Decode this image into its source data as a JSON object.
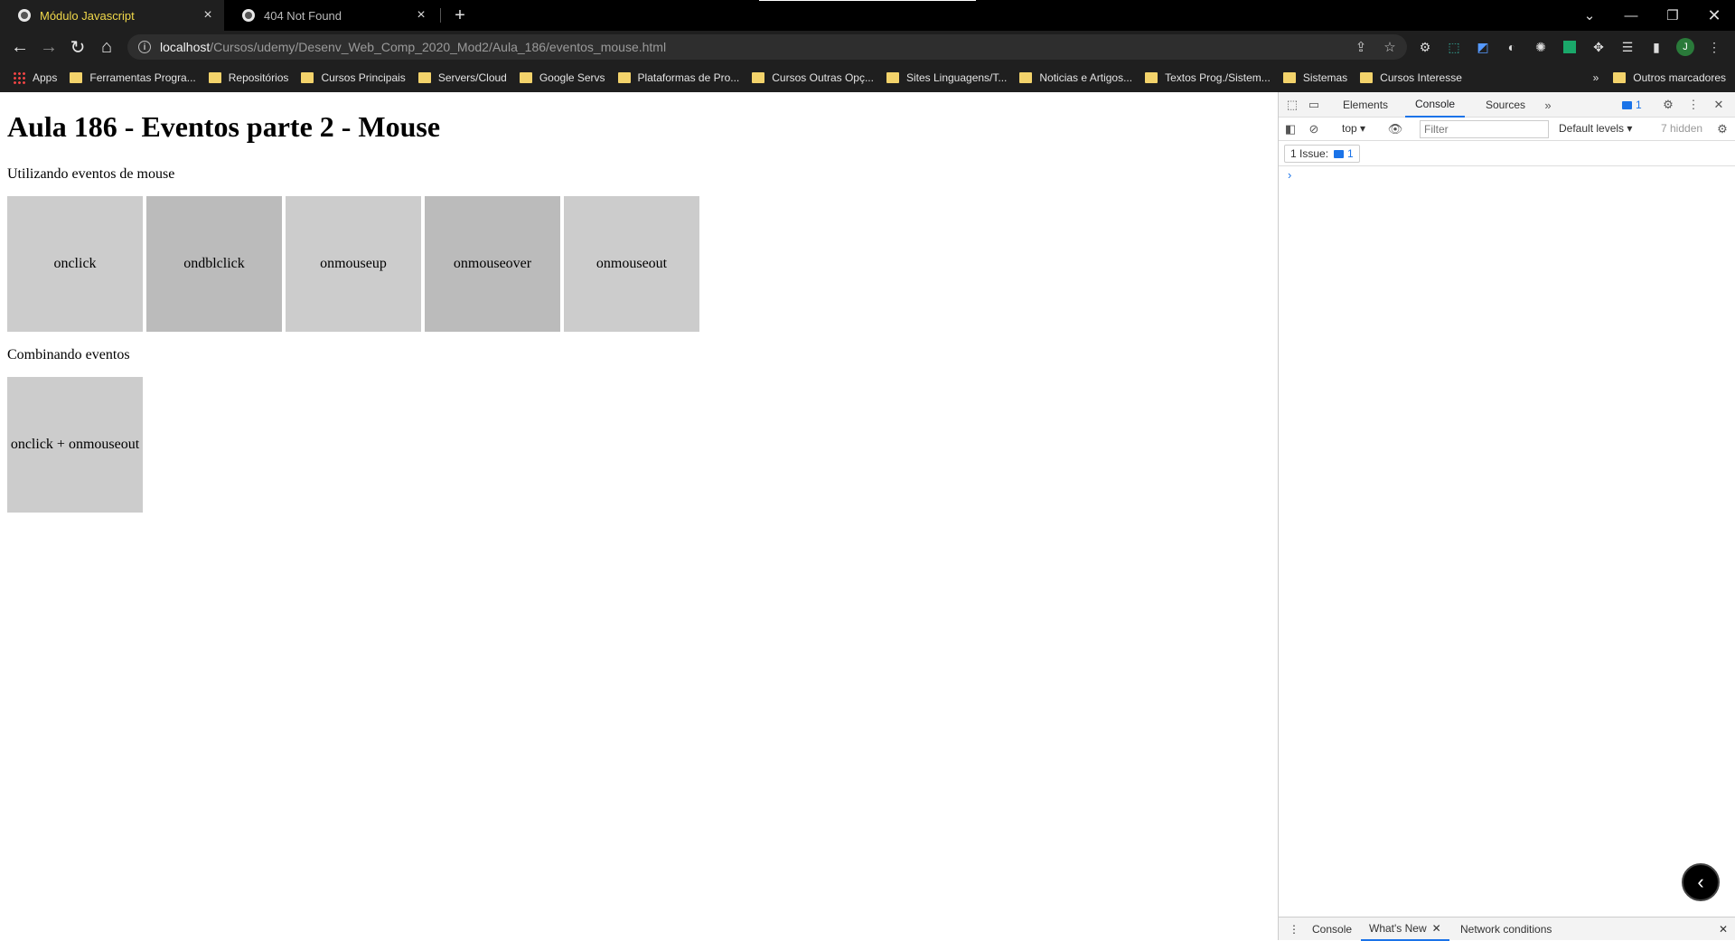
{
  "browser": {
    "tabs": [
      {
        "title": "Módulo Javascript",
        "active": true
      },
      {
        "title": "404 Not Found",
        "active": false
      }
    ],
    "new_tab": "+",
    "url_host": "localhost",
    "url_path": "/Cursos/udemy/Desenv_Web_Comp_2020_Mod2/Aula_186/eventos_mouse.html",
    "profile_initial": "J",
    "bookmarks": [
      "Apps",
      "Ferramentas Progra...",
      "Repositórios",
      "Cursos Principais",
      "Servers/Cloud",
      "Google Servs",
      "Plataformas de Pro...",
      "Cursos Outras Opç...",
      "Sites Linguagens/T...",
      "Noticias e Artigos...",
      "Textos Prog./Sistem...",
      "Sistemas",
      "Cursos Interesse"
    ],
    "bookmarks_more": "»",
    "other_bookmarks": "Outros marcadores"
  },
  "page": {
    "title": "Aula 186 - Eventos parte 2 - Mouse",
    "section1": "Utilizando eventos de mouse",
    "boxes": [
      "onclick",
      "ondblclick",
      "onmouseup",
      "onmouseover",
      "onmouseout"
    ],
    "section2": "Combinando eventos",
    "combo_box": "onclick + onmouseout"
  },
  "devtools": {
    "tabs": [
      "Elements",
      "Console",
      "Sources"
    ],
    "active_tab": "Console",
    "more": "»",
    "issues_count": "1",
    "context": "top",
    "filter_placeholder": "Filter",
    "levels": "Default levels",
    "hidden": "7 hidden",
    "issue_label": "1 Issue:",
    "issue_count": "1",
    "prompt": "›",
    "drawer_tabs": [
      "Console",
      "What's New",
      "Network conditions"
    ],
    "drawer_active": "What's New"
  },
  "colors": {
    "box_light": "#cccccc",
    "box_dark": "#bbbbbb",
    "accent": "#1a73e8",
    "active_tab_text": "#f0d84a"
  }
}
